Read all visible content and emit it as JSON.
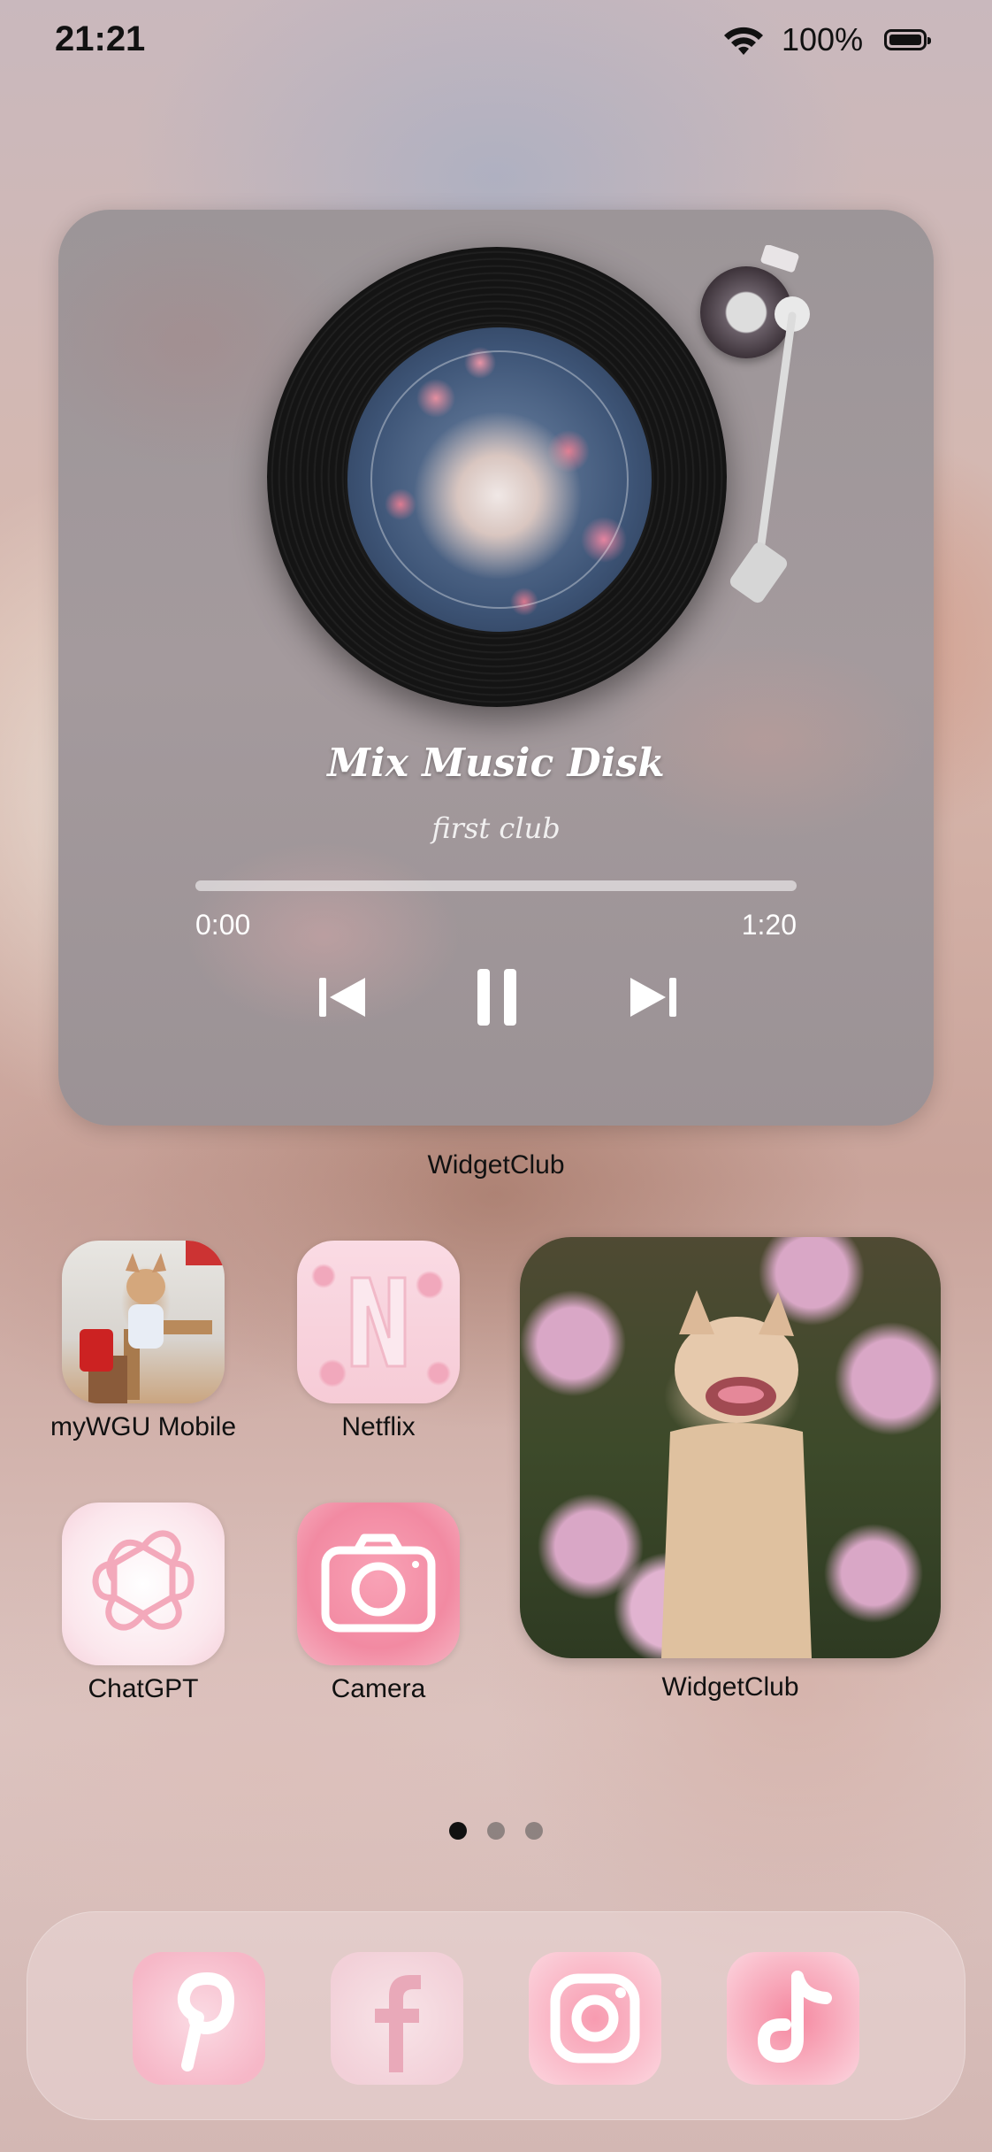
{
  "status_bar": {
    "time": "21:21",
    "battery_percent": "100%"
  },
  "music_widget": {
    "song_title": "Mix Music Disk",
    "artist": "first club",
    "time_elapsed": "0:00",
    "time_total": "1:20",
    "progress": 0.0,
    "label": "WidgetClub"
  },
  "apps": [
    {
      "label": "myWGU Mobile",
      "icon": "chihuahua-desk-photo-icon"
    },
    {
      "label": "Netflix",
      "icon": "netflix-n-icon"
    },
    {
      "label": "ChatGPT",
      "icon": "openai-logo-icon"
    },
    {
      "label": "Camera",
      "icon": "camera-icon"
    }
  ],
  "photo_widget": {
    "label": "WidgetClub",
    "icon": "chihuahua-flowers-photo"
  },
  "page_indicator": {
    "count": 3,
    "active": 1
  },
  "dock": [
    {
      "name": "Pinterest",
      "icon": "pinterest-icon"
    },
    {
      "name": "Facebook",
      "icon": "facebook-icon"
    },
    {
      "name": "Instagram",
      "icon": "instagram-icon"
    },
    {
      "name": "TikTok",
      "icon": "tiktok-icon"
    }
  ],
  "colors": {
    "accent_pink": "#f28aa2",
    "text_dark": "#111111"
  }
}
